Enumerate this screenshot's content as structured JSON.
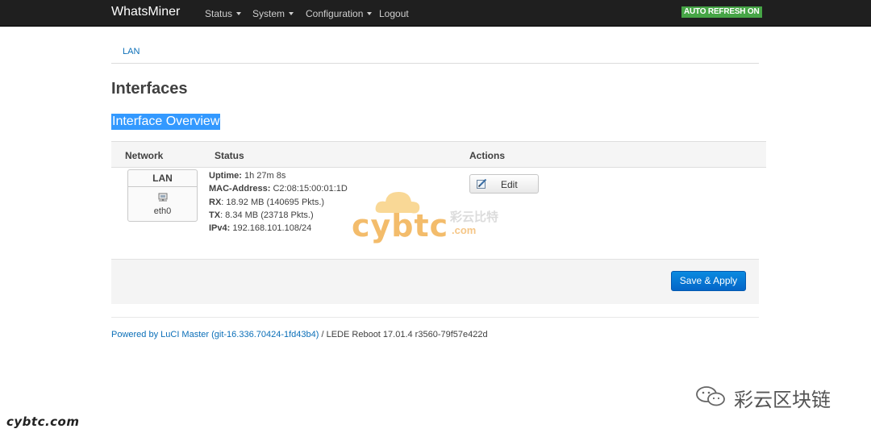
{
  "navbar": {
    "brand": "WhatsMiner",
    "menu": [
      {
        "label": "Status",
        "dropdown": true
      },
      {
        "label": "System",
        "dropdown": true
      },
      {
        "label": "Configuration",
        "dropdown": true
      },
      {
        "label": "Logout",
        "dropdown": false
      }
    ],
    "auto_refresh": "AUTO REFRESH ON"
  },
  "breadcrumb": {
    "tab": "LAN"
  },
  "page": {
    "title": "Interfaces",
    "section_title": "Interface Overview"
  },
  "table": {
    "headers": {
      "network": "Network",
      "status": "Status",
      "actions": "Actions"
    },
    "rows": [
      {
        "network_name": "LAN",
        "device": "eth0",
        "icon": "network-port-icon",
        "status": [
          {
            "label": "Uptime:",
            "value": "1h 27m 8s"
          },
          {
            "label": "MAC-Address:",
            "value": "C2:08:15:00:01:1D"
          },
          {
            "label": "RX",
            "value": ": 18.92 MB (140695 Pkts.)"
          },
          {
            "label": "TX",
            "value": ": 8.34 MB (23718 Pkts.)"
          },
          {
            "label": "IPv4:",
            "value": "192.168.101.108/24"
          }
        ],
        "action": {
          "label": "Edit",
          "icon": "edit-icon"
        }
      }
    ]
  },
  "actions": {
    "save_apply": "Save & Apply"
  },
  "footer": {
    "link_text": "Powered by LuCI Master (git-16.336.70424-1fd43b4)",
    "rest_text": " / LEDE Reboot 17.01.4 r3560-79f57e422d"
  },
  "watermarks": {
    "center_main": "cybtc",
    "center_cn": "彩云比特",
    "center_com": ".com",
    "bottom_left": "cybtc.com",
    "bottom_right": "彩云区块链"
  },
  "colors": {
    "navbar": "#1f1f1f",
    "auto_refresh": "#46a546",
    "link": "#0b6fb8",
    "primary_button": "#0466c8",
    "selection": "#3399ff"
  }
}
